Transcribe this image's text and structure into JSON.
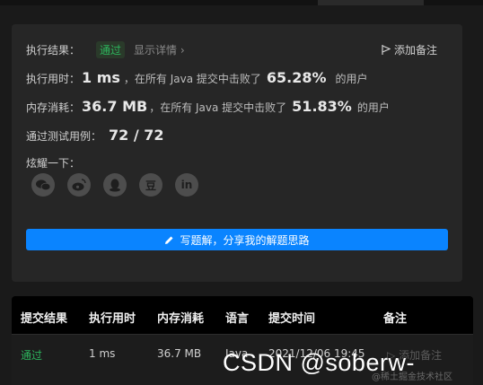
{
  "colors": {
    "accent": "#0a84ff",
    "success": "#2db55d",
    "card_bg": "#262626"
  },
  "result": {
    "label": "执行结果：",
    "status": "通过",
    "detail_link": "显示详情",
    "add_note": "添加备注"
  },
  "runtime": {
    "label": "执行用时：",
    "value": "1 ms",
    "middle": "，在所有 Java 提交中击败了",
    "percent": "65.28%",
    "suffix": "的用户"
  },
  "memory": {
    "label": "内存消耗：",
    "value": "36.7 MB",
    "middle": "，在所有 Java 提交中击败了",
    "percent": "51.83%",
    "suffix": "的用户"
  },
  "tests": {
    "label": "通过测试用例：",
    "value": "72 / 72"
  },
  "share": {
    "label": "炫耀一下：",
    "icons": [
      "wechat-icon",
      "weibo-icon",
      "qq-icon",
      "douban-icon",
      "linkedin-icon"
    ],
    "douban_glyph": "豆",
    "linkedin_glyph": "in"
  },
  "write_solution": {
    "label": "写题解，分享我的解题思路"
  },
  "table": {
    "headers": [
      "提交结果",
      "执行用时",
      "内存消耗",
      "语言",
      "提交时间",
      "备注"
    ],
    "rows": [
      {
        "status": "通过",
        "runtime": "1 ms",
        "memory": "36.7 MB",
        "language": "Java",
        "time": "2021/12/06 19:45",
        "note": "添加备注"
      }
    ]
  },
  "watermark": {
    "text": "CSDN @soberw-",
    "small": "@稀土掘金技术社区"
  }
}
